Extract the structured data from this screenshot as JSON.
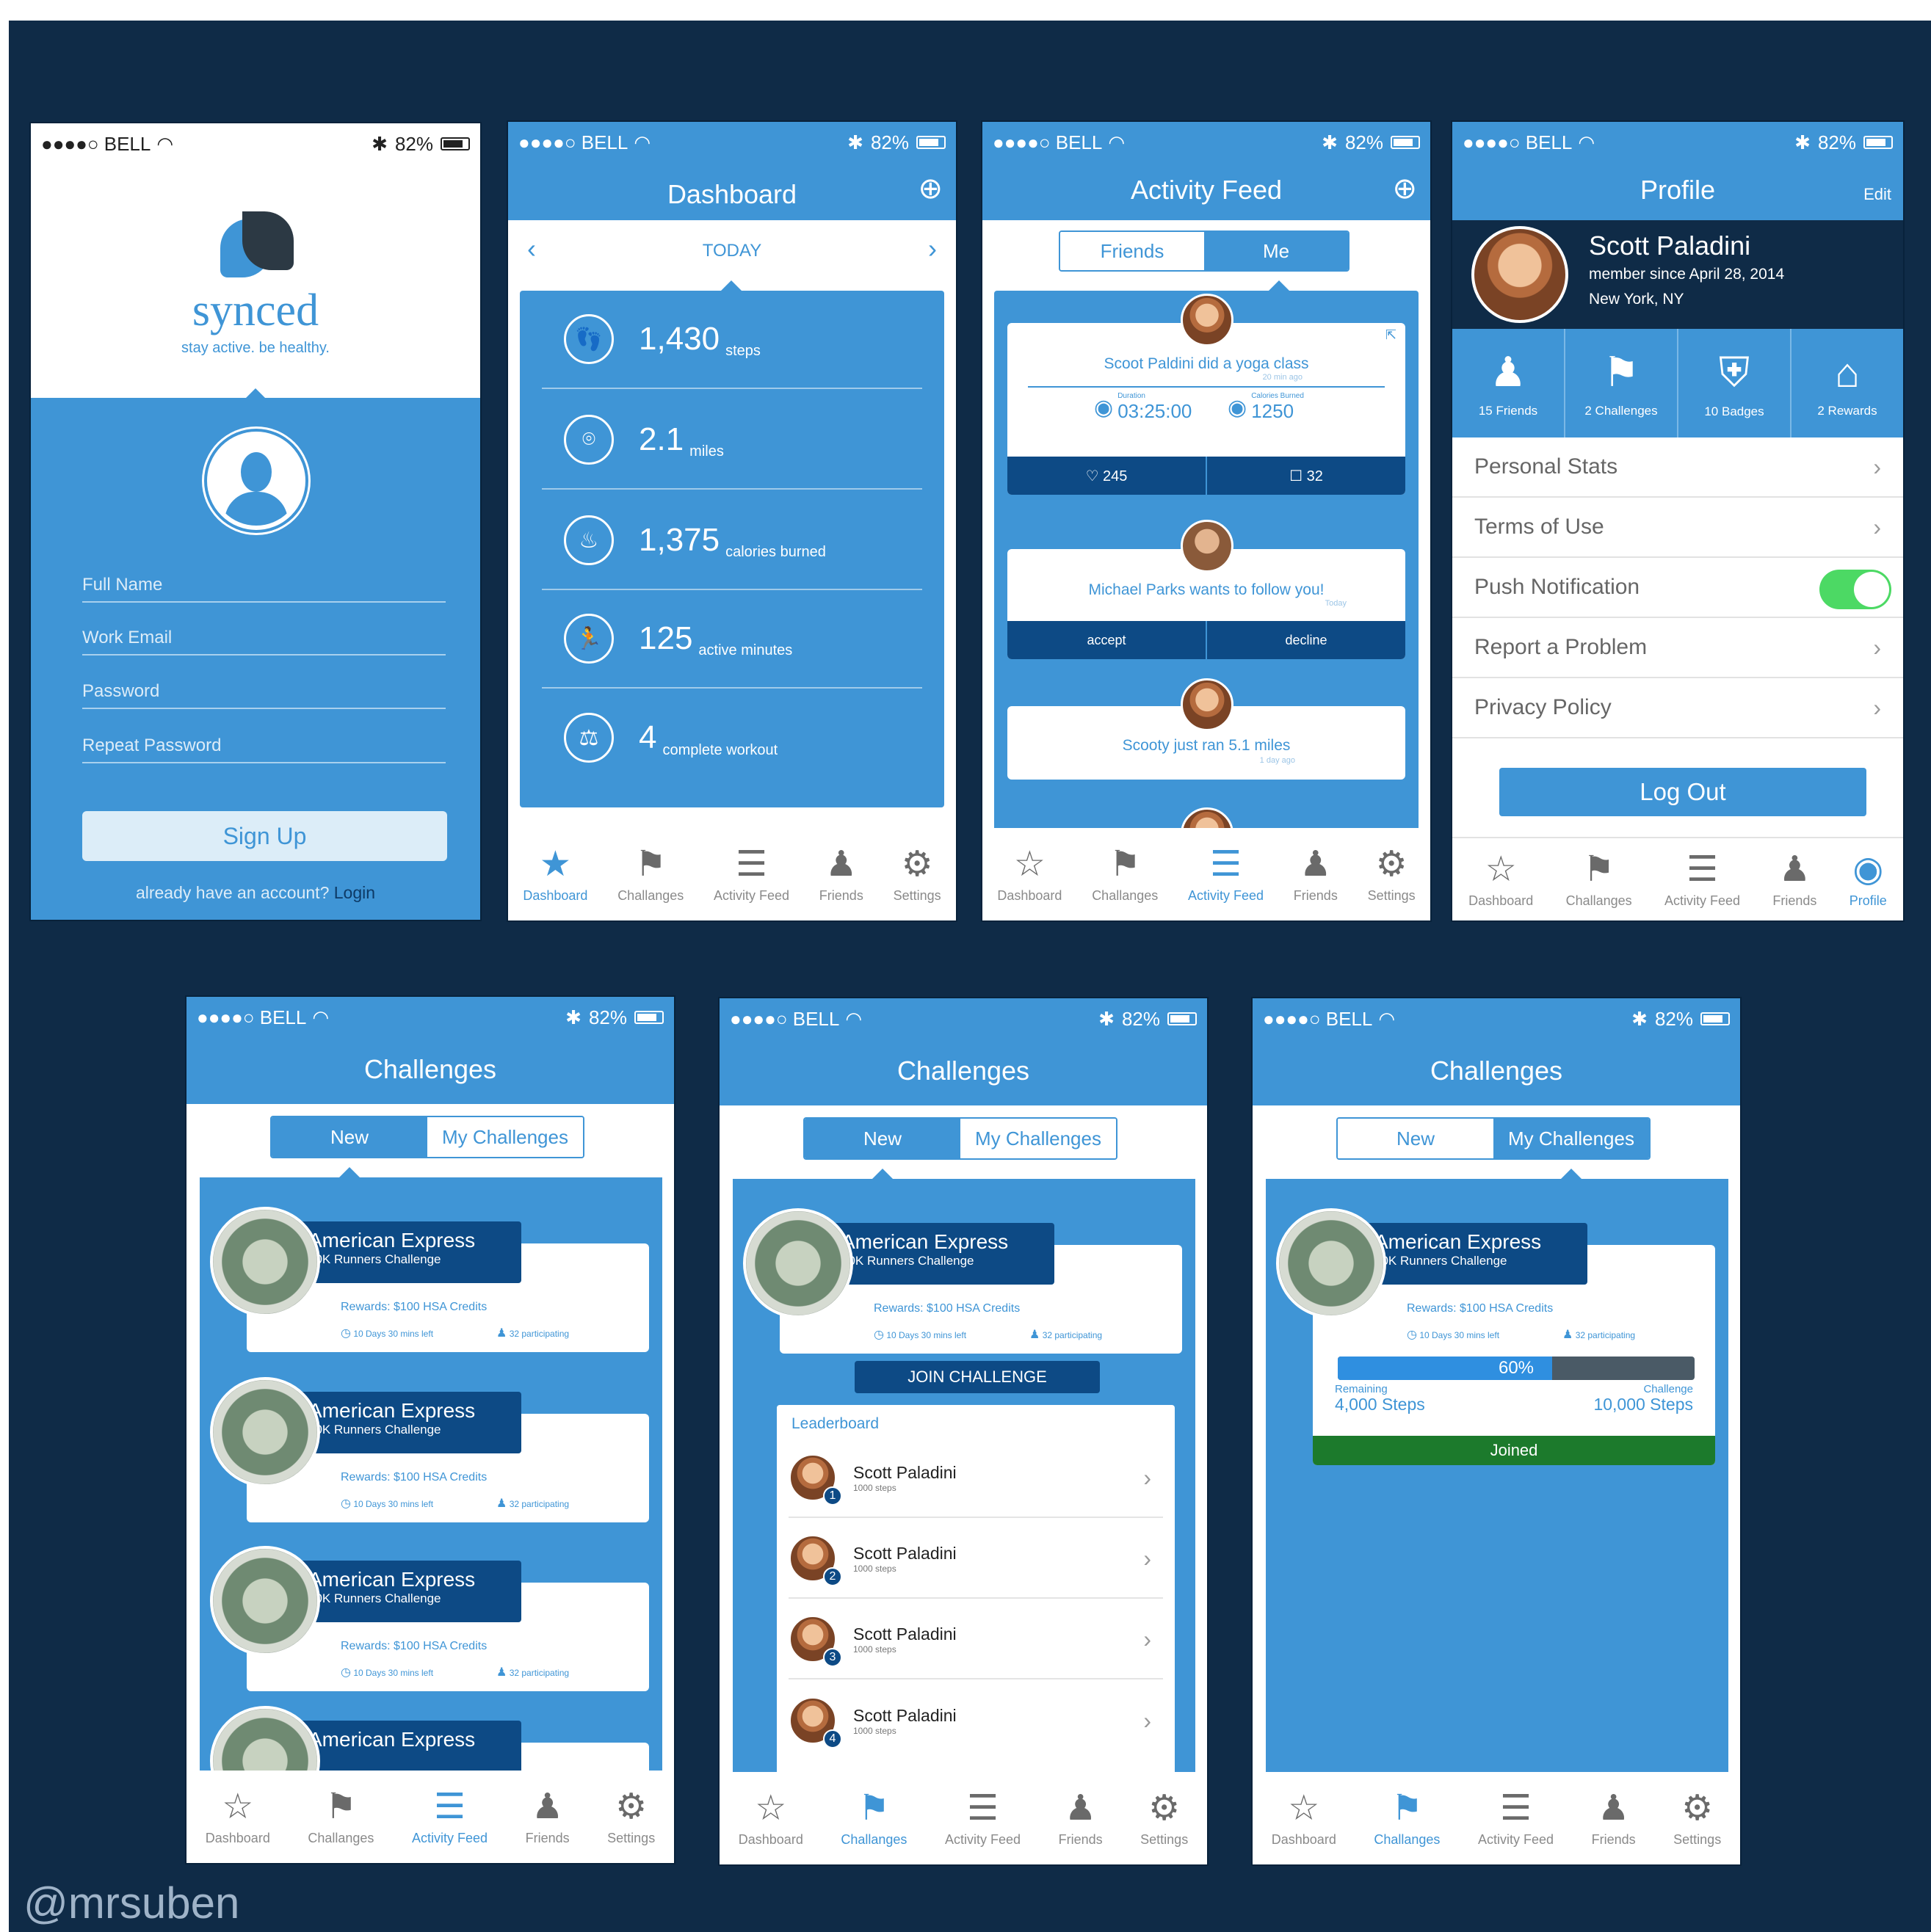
{
  "status": {
    "carrier": "●●●●○ BELL",
    "battery": "82%"
  },
  "tabs": {
    "dashboard": "Dashboard",
    "challenges": "Challanges",
    "activity": "Activity Feed",
    "friends": "Friends",
    "settings": "Settings",
    "profile": "Profile"
  },
  "signup": {
    "brand": "synced",
    "tagline": "stay active. be healthy.",
    "fields": [
      "Full Name",
      "Work Email",
      "Password",
      "Repeat Password"
    ],
    "signup_label": "Sign Up",
    "login_prompt": "already have an account?",
    "login_link": "Login"
  },
  "dashboard": {
    "title": "Dashboard",
    "day": "TODAY",
    "stats": [
      {
        "value": "1,430",
        "unit": "steps"
      },
      {
        "value": "2.1",
        "unit": "miles"
      },
      {
        "value": "1,375",
        "unit": "calories burned"
      },
      {
        "value": "125",
        "unit": "active minutes"
      },
      {
        "value": "4",
        "unit": "complete workout"
      }
    ]
  },
  "feed": {
    "title": "Activity Feed",
    "seg_friends": "Friends",
    "seg_me": "Me",
    "item1": {
      "text": "Scoot Paldini did a yoga class",
      "time": "20 min ago",
      "duration_label": "Duration",
      "duration": "03:25:00",
      "cal_label": "Calories Burned",
      "calories": "1250",
      "likes": "♡ 245",
      "comments": "☐ 32"
    },
    "item2": {
      "text": "Michael Parks wants to follow you!",
      "time": "Today",
      "accept": "accept",
      "decline": "decline"
    },
    "item3": {
      "text": "Scooty just ran 5.1 miles",
      "time": "1 day ago"
    }
  },
  "profile": {
    "title": "Profile",
    "edit": "Edit",
    "name": "Scott Paladini",
    "since": "member since  April 28, 2014",
    "location": "New York, NY",
    "counts": [
      "15 Friends",
      "2 Challenges",
      "10 Badges",
      "2 Rewards"
    ],
    "rows": [
      "Personal Stats",
      "Terms of Use",
      "Push Notification",
      "Report a Problem",
      "Privacy Policy"
    ],
    "logout": "Log Out"
  },
  "challenges": {
    "title": "Challenges",
    "seg_new": "New",
    "seg_mine": "My Challenges",
    "card": {
      "name": "American Express",
      "sub": "10K Runners Challenge",
      "reward": "Rewards: $100 HSA Credits",
      "time": "10 Days 30 mins left",
      "people": "32 participating"
    },
    "join": "JOIN CHALLENGE",
    "leaderboard": "Leaderboard",
    "leaders": [
      {
        "name": "Scott Paladini",
        "steps": "1000 steps",
        "rank": "1"
      },
      {
        "name": "Scott Paladini",
        "steps": "1000 steps",
        "rank": "2"
      },
      {
        "name": "Scott Paladini",
        "steps": "1000 steps",
        "rank": "3"
      },
      {
        "name": "Scott Paladini",
        "steps": "1000 steps",
        "rank": "4"
      }
    ],
    "progress": {
      "pct_label": "60%",
      "fraction": 0.6,
      "remaining_label": "Remaining",
      "remaining": "4,000 Steps",
      "challenge_label": "Challenge",
      "challenge": "10,000 Steps"
    },
    "joined": "Joined"
  },
  "watermark": "@mrsuben",
  "colors": {
    "primary": "#3f95d6",
    "dark": "#0d4a85",
    "background": "#0f2b47",
    "joined": "#1c7a2c"
  }
}
